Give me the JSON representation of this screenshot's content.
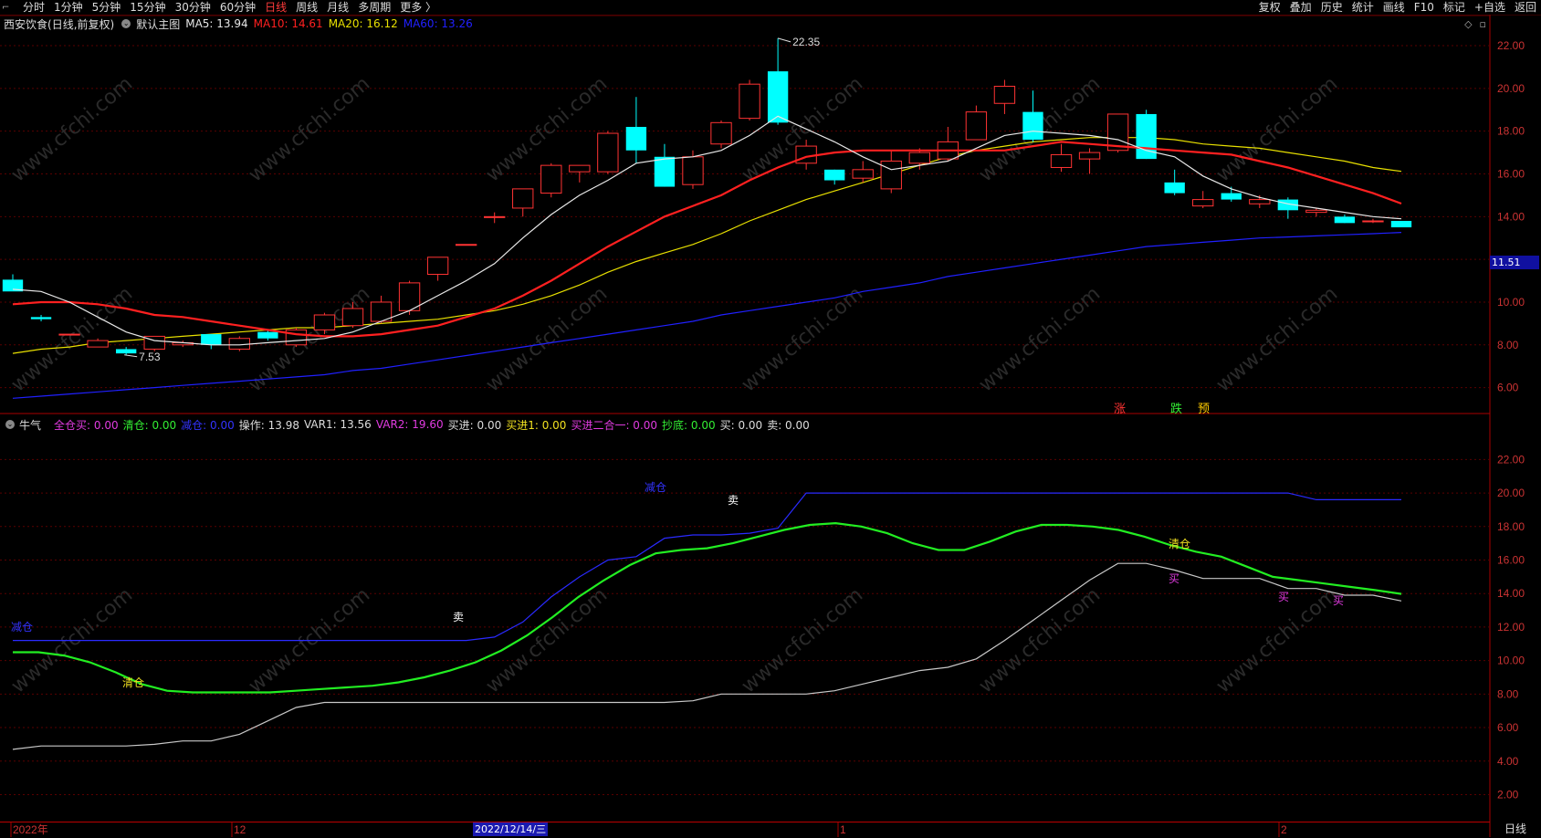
{
  "toolbar": {
    "left": [
      {
        "label": "分时",
        "active": false
      },
      {
        "label": "1分钟",
        "active": false
      },
      {
        "label": "5分钟",
        "active": false
      },
      {
        "label": "15分钟",
        "active": false
      },
      {
        "label": "30分钟",
        "active": false
      },
      {
        "label": "60分钟",
        "active": false
      },
      {
        "label": "日线",
        "active": true
      },
      {
        "label": "周线",
        "active": false
      },
      {
        "label": "月线",
        "active": false
      },
      {
        "label": "多周期",
        "active": false
      },
      {
        "label": "更多 〉",
        "active": false
      }
    ],
    "right": [
      "复权",
      "叠加",
      "历史",
      "统计",
      "画线",
      "F10",
      "标记",
      "+自选",
      "返回"
    ]
  },
  "main_info": {
    "stock": "西安饮食",
    "mode": "(日线,前复权)",
    "template": "默认主图",
    "ma5": "MA5: 13.94",
    "ma10": "MA10: 14.61",
    "ma20": "MA20: 16.12",
    "ma60": "MA60: 13.26"
  },
  "sub_info": {
    "name": "牛气",
    "items": [
      {
        "text": "全仓买: 0.00",
        "color": "#e03be0"
      },
      {
        "text": "清仓: 0.00",
        "color": "#33ee33"
      },
      {
        "text": "减仓: 0.00",
        "color": "#3333ff"
      },
      {
        "text": "操作: 13.98",
        "color": "#dddddd"
      },
      {
        "text": "VAR1: 13.56",
        "color": "#dddddd"
      },
      {
        "text": "VAR2: 19.60",
        "color": "#e03be0"
      },
      {
        "text": "买进: 0.00",
        "color": "#dddddd"
      },
      {
        "text": "买进1: 0.00",
        "color": "#f0e020"
      },
      {
        "text": "买进二合一: 0.00",
        "color": "#e03be0"
      },
      {
        "text": "抄底: 0.00",
        "color": "#33ee33"
      },
      {
        "text": "买: 0.00",
        "color": "#dddddd"
      },
      {
        "text": "卖: 0.00",
        "color": "#dddddd"
      }
    ]
  },
  "price_axis": [
    "22.00",
    "20.00",
    "18.00",
    "16.00",
    "14.00",
    "10.00",
    "8.00",
    "6.00"
  ],
  "last_price": "11.51",
  "sub_axis": [
    "22.00",
    "20.00",
    "18.00",
    "16.00",
    "14.00",
    "12.00",
    "10.00",
    "8.00",
    "6.00",
    "4.00",
    "2.00"
  ],
  "annotations": {
    "high": "22.35",
    "low": "7.53",
    "markers": [
      {
        "text": "涨",
        "color": "#ff3333"
      },
      {
        "text": "跌",
        "color": "#33ee33"
      },
      {
        "text": "预",
        "color": "#ffcc00"
      }
    ],
    "sub_labels": [
      {
        "text": "减仓",
        "color": "#3333ff"
      },
      {
        "text": "清仓",
        "color": "#f0e020"
      },
      {
        "text": "卖",
        "color": "#ffffff"
      },
      {
        "text": "减仓",
        "color": "#3333ff"
      },
      {
        "text": "卖",
        "color": "#ffffff"
      },
      {
        "text": "清仓",
        "color": "#f0e020"
      },
      {
        "text": "买",
        "color": "#e03be0"
      },
      {
        "text": "买",
        "color": "#e03be0"
      },
      {
        "text": "买",
        "color": "#e03be0"
      }
    ]
  },
  "date_axis": [
    "2022年",
    "12",
    "2022/12/14/三",
    "1",
    "2"
  ],
  "period": "日线",
  "watermark": "www.cfchi.com",
  "colors": {
    "ma5": "#e8e8e8",
    "ma10": "#ff2020",
    "ma20": "#e8e000",
    "ma60": "#2020ff",
    "up": "#ff3333",
    "down": "#00ffff"
  },
  "chart_data": {
    "type": "candlestick",
    "candles": [
      {
        "o": 11.05,
        "h": 11.3,
        "l": 10.6,
        "c": 10.5
      },
      {
        "o": 9.3,
        "h": 9.4,
        "l": 9.1,
        "c": 9.2
      },
      {
        "o": 8.5,
        "h": 8.5,
        "l": 8.5,
        "c": 8.5
      },
      {
        "o": 7.9,
        "h": 8.3,
        "l": 7.9,
        "c": 8.2
      },
      {
        "o": 7.8,
        "h": 7.9,
        "l": 7.53,
        "c": 7.6
      },
      {
        "o": 7.8,
        "h": 8.4,
        "l": 7.7,
        "c": 8.4
      },
      {
        "o": 8.0,
        "h": 8.2,
        "l": 7.9,
        "c": 8.1
      },
      {
        "o": 8.5,
        "h": 8.5,
        "l": 7.8,
        "c": 8.0
      },
      {
        "o": 7.8,
        "h": 8.4,
        "l": 7.7,
        "c": 8.3
      },
      {
        "o": 8.6,
        "h": 8.7,
        "l": 8.2,
        "c": 8.3
      },
      {
        "o": 8.0,
        "h": 8.8,
        "l": 7.9,
        "c": 8.7
      },
      {
        "o": 8.7,
        "h": 9.5,
        "l": 8.5,
        "c": 9.4
      },
      {
        "o": 8.9,
        "h": 10.0,
        "l": 8.8,
        "c": 9.7
      },
      {
        "o": 9.1,
        "h": 10.3,
        "l": 9.0,
        "c": 10.0
      },
      {
        "o": 9.6,
        "h": 11.0,
        "l": 9.4,
        "c": 10.9
      },
      {
        "o": 11.3,
        "h": 12.1,
        "l": 11.0,
        "c": 12.1
      },
      {
        "o": 12.7,
        "h": 12.7,
        "l": 12.7,
        "c": 12.7
      },
      {
        "o": 14.0,
        "h": 14.2,
        "l": 13.7,
        "c": 14.0
      },
      {
        "o": 14.4,
        "h": 15.3,
        "l": 14.0,
        "c": 15.3
      },
      {
        "o": 15.1,
        "h": 16.5,
        "l": 14.9,
        "c": 16.4
      },
      {
        "o": 16.1,
        "h": 16.4,
        "l": 15.6,
        "c": 16.4
      },
      {
        "o": 16.1,
        "h": 18.0,
        "l": 16.0,
        "c": 17.9
      },
      {
        "o": 18.2,
        "h": 19.6,
        "l": 16.5,
        "c": 17.1
      },
      {
        "o": 16.8,
        "h": 17.4,
        "l": 15.4,
        "c": 15.4
      },
      {
        "o": 15.5,
        "h": 17.1,
        "l": 15.3,
        "c": 16.8
      },
      {
        "o": 17.4,
        "h": 18.5,
        "l": 17.2,
        "c": 18.4
      },
      {
        "o": 18.6,
        "h": 20.4,
        "l": 18.5,
        "c": 20.2
      },
      {
        "o": 20.8,
        "h": 22.35,
        "l": 18.3,
        "c": 18.4
      },
      {
        "o": 16.5,
        "h": 17.6,
        "l": 16.2,
        "c": 17.3
      },
      {
        "o": 16.2,
        "h": 16.2,
        "l": 15.5,
        "c": 15.7
      },
      {
        "o": 15.8,
        "h": 16.6,
        "l": 15.6,
        "c": 16.2
      },
      {
        "o": 15.3,
        "h": 17.1,
        "l": 15.1,
        "c": 16.6
      },
      {
        "o": 16.5,
        "h": 17.2,
        "l": 16.2,
        "c": 17.0
      },
      {
        "o": 16.7,
        "h": 18.2,
        "l": 16.6,
        "c": 17.5
      },
      {
        "o": 17.6,
        "h": 19.2,
        "l": 17.6,
        "c": 18.9
      },
      {
        "o": 19.3,
        "h": 20.4,
        "l": 18.8,
        "c": 20.1
      },
      {
        "o": 18.9,
        "h": 19.9,
        "l": 17.5,
        "c": 17.6
      },
      {
        "o": 16.3,
        "h": 17.4,
        "l": 16.1,
        "c": 16.9
      },
      {
        "o": 16.7,
        "h": 17.2,
        "l": 16.0,
        "c": 17.0
      },
      {
        "o": 17.1,
        "h": 18.8,
        "l": 17.0,
        "c": 18.8
      },
      {
        "o": 18.8,
        "h": 19.0,
        "l": 16.7,
        "c": 16.7
      },
      {
        "o": 15.6,
        "h": 16.2,
        "l": 15.0,
        "c": 15.1
      },
      {
        "o": 14.5,
        "h": 15.2,
        "l": 14.4,
        "c": 14.8
      },
      {
        "o": 15.1,
        "h": 15.4,
        "l": 14.7,
        "c": 14.8
      },
      {
        "o": 14.6,
        "h": 15.0,
        "l": 14.4,
        "c": 14.8
      },
      {
        "o": 14.8,
        "h": 14.9,
        "l": 13.9,
        "c": 14.3
      },
      {
        "o": 14.2,
        "h": 14.4,
        "l": 14.0,
        "c": 14.3
      },
      {
        "o": 14.0,
        "h": 14.1,
        "l": 13.7,
        "c": 13.7
      },
      {
        "o": 13.8,
        "h": 13.9,
        "l": 13.7,
        "c": 13.8
      },
      {
        "o": 13.8,
        "h": 13.8,
        "l": 13.5,
        "c": 13.5
      }
    ],
    "ma5": [
      10.6,
      10.5,
      10.0,
      9.3,
      8.6,
      8.2,
      8.1,
      8.0,
      8.0,
      8.1,
      8.2,
      8.3,
      8.6,
      9.1,
      9.6,
      10.3,
      11.0,
      11.8,
      13.0,
      14.1,
      15.0,
      15.7,
      16.5,
      16.7,
      16.8,
      17.1,
      17.8,
      18.7,
      18.1,
      17.5,
      16.8,
      16.2,
      16.4,
      16.6,
      17.2,
      17.8,
      18.0,
      17.9,
      17.8,
      17.6,
      17.1,
      16.8,
      15.9,
      15.3,
      14.9,
      14.6,
      14.4,
      14.2,
      14.0,
      13.9
    ],
    "ma10": [
      9.9,
      10.0,
      10.0,
      9.9,
      9.7,
      9.4,
      9.3,
      9.1,
      8.9,
      8.7,
      8.5,
      8.4,
      8.4,
      8.5,
      8.7,
      8.9,
      9.3,
      9.7,
      10.3,
      11.0,
      11.8,
      12.6,
      13.3,
      14.0,
      14.5,
      15.0,
      15.7,
      16.3,
      16.8,
      17.0,
      17.1,
      17.1,
      17.1,
      17.1,
      17.1,
      17.1,
      17.3,
      17.5,
      17.4,
      17.3,
      17.2,
      17.1,
      17.0,
      16.9,
      16.6,
      16.3,
      15.9,
      15.5,
      15.1,
      14.61
    ],
    "ma20": [
      7.6,
      7.8,
      7.9,
      8.1,
      8.2,
      8.3,
      8.4,
      8.5,
      8.6,
      8.7,
      8.8,
      8.8,
      8.9,
      9.0,
      9.1,
      9.2,
      9.4,
      9.6,
      9.9,
      10.3,
      10.8,
      11.4,
      11.9,
      12.3,
      12.7,
      13.2,
      13.8,
      14.3,
      14.8,
      15.2,
      15.6,
      16.0,
      16.4,
      16.8,
      17.1,
      17.3,
      17.5,
      17.6,
      17.7,
      17.7,
      17.7,
      17.6,
      17.4,
      17.3,
      17.2,
      17.0,
      16.8,
      16.6,
      16.3,
      16.12
    ],
    "ma60": [
      5.5,
      5.6,
      5.7,
      5.8,
      5.9,
      6.0,
      6.1,
      6.2,
      6.3,
      6.4,
      6.5,
      6.6,
      6.8,
      6.9,
      7.1,
      7.3,
      7.5,
      7.7,
      7.9,
      8.1,
      8.3,
      8.5,
      8.7,
      8.9,
      9.1,
      9.4,
      9.6,
      9.8,
      10.0,
      10.2,
      10.5,
      10.7,
      10.9,
      11.2,
      11.4,
      11.6,
      11.8,
      12.0,
      12.2,
      12.4,
      12.6,
      12.7,
      12.8,
      12.9,
      13.0,
      13.05,
      13.1,
      13.15,
      13.2,
      13.26
    ],
    "sub_white": [
      4.7,
      4.9,
      4.9,
      4.9,
      4.9,
      5.0,
      5.2,
      5.2,
      5.6,
      6.4,
      7.2,
      7.5,
      7.5,
      7.5,
      7.5,
      7.5,
      7.5,
      7.5,
      7.5,
      7.5,
      7.5,
      7.5,
      7.5,
      7.5,
      7.6,
      8.0,
      8.0,
      8.0,
      8.0,
      8.2,
      8.6,
      9.0,
      9.4,
      9.6,
      10.1,
      11.2,
      12.4,
      13.6,
      14.8,
      15.8,
      15.8,
      15.4,
      14.9,
      14.9,
      14.9,
      14.3,
      14.3,
      13.9,
      13.9,
      13.56
    ],
    "sub_green": [
      10.5,
      10.5,
      10.3,
      9.9,
      9.3,
      8.6,
      8.2,
      8.1,
      8.1,
      8.1,
      8.1,
      8.2,
      8.3,
      8.4,
      8.5,
      8.7,
      9.0,
      9.4,
      9.9,
      10.6,
      11.5,
      12.6,
      13.8,
      14.8,
      15.7,
      16.4,
      16.6,
      16.7,
      17.0,
      17.4,
      17.8,
      18.1,
      18.2,
      18.0,
      17.6,
      17.0,
      16.6,
      16.6,
      17.1,
      17.7,
      18.1,
      18.1,
      18.0,
      17.8,
      17.4,
      16.9,
      16.5,
      16.2,
      15.6,
      15.0,
      14.8,
      14.6,
      14.4,
      14.2,
      13.98
    ],
    "sub_blue": [
      11.2,
      11.2,
      11.2,
      11.2,
      11.2,
      11.2,
      11.2,
      11.2,
      11.2,
      11.2,
      11.2,
      11.2,
      11.2,
      11.2,
      11.2,
      11.2,
      11.2,
      11.4,
      12.3,
      13.8,
      15.0,
      16.0,
      16.2,
      17.3,
      17.5,
      17.5,
      17.6,
      17.9,
      20.0,
      20.0,
      20.0,
      20.0,
      20.0,
      20.0,
      20.0,
      20.0,
      20.0,
      20.0,
      20.0,
      20.0,
      20.0,
      20.0,
      20.0,
      20.0,
      20.0,
      20.0,
      19.6,
      19.6,
      19.6,
      19.6
    ],
    "price_ylim": [
      5.0,
      22.6
    ],
    "sub_ylim": [
      0.5,
      23.6
    ]
  }
}
